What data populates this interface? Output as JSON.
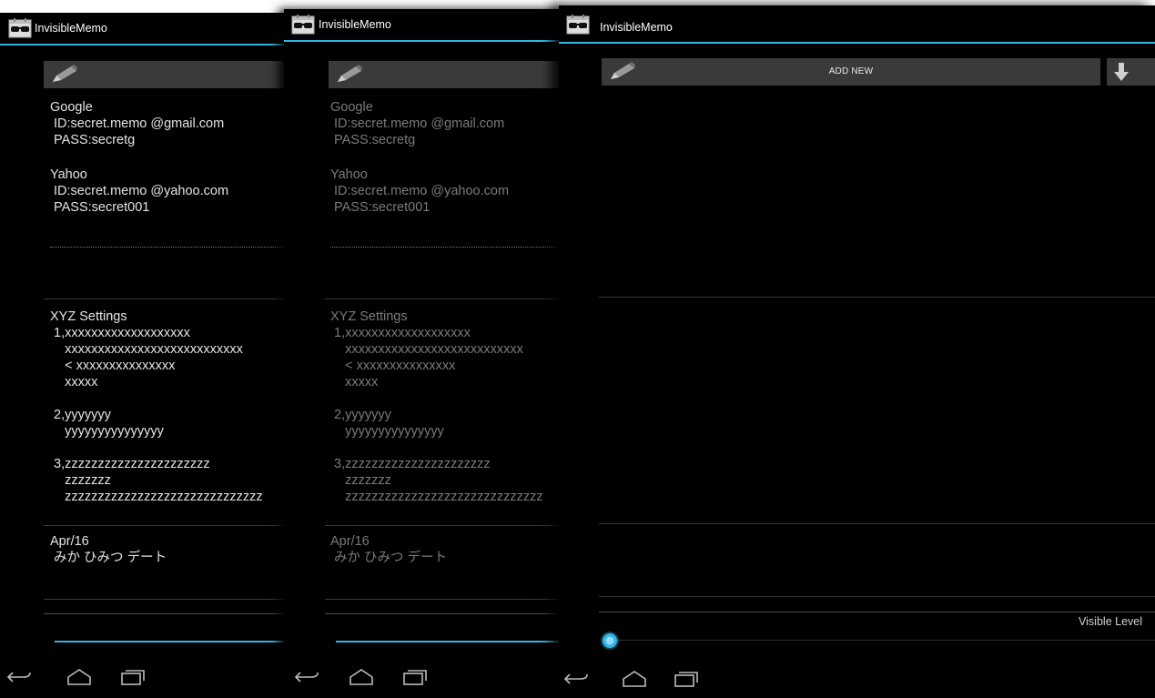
{
  "app": {
    "title": "InvisibleMemo"
  },
  "colors": {
    "accent": "#33b5e5",
    "background": "#000000",
    "bar": "#3a3a3a"
  },
  "icons": {
    "app": "sunglasses-icon",
    "edit": "pencil-icon",
    "download": "arrow-down-icon",
    "back": "back-icon",
    "home": "home-icon",
    "recents": "recent-apps-icon"
  },
  "memos": [
    {
      "title": "Google",
      "body": " ID:secret.memo @gmail.com\n PASS:secretg"
    },
    {
      "title": "Yahoo",
      "body": " ID:secret.memo @yahoo.com\n PASS:secret001"
    },
    {
      "title": "XYZ Settings",
      "body": " 1,xxxxxxxxxxxxxxxxxxx\n    xxxxxxxxxxxxxxxxxxxxxxxxxxx\n    < xxxxxxxxxxxxxxx\n    xxxxx\n\n 2,yyyyyyy\n    yyyyyyyyyyyyyyy\n\n 3,zzzzzzzzzzzzzzzzzzzzzz\n    zzzzzzz\n    zzzzzzzzzzzzzzzzzzzzzzzzzzzzzz"
    },
    {
      "title": "Apr/16",
      "body": " みか ひみつ デート"
    }
  ],
  "screen3": {
    "add_new_label": "ADD NEW",
    "visible_level_label": "Visible Level",
    "visible_level_value": 0
  }
}
